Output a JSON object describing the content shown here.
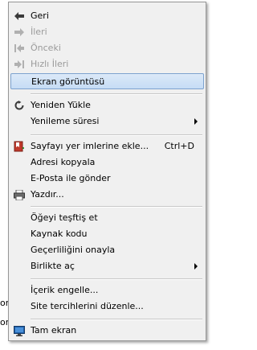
{
  "background": {
    "fragments": [
      "on",
      "on"
    ]
  },
  "menu": {
    "items": [
      {
        "label": "Geri",
        "icon": "back-arrow-icon",
        "enabled": true
      },
      {
        "label": "İleri",
        "icon": "forward-arrow-icon",
        "enabled": false
      },
      {
        "label": "Önceki",
        "icon": "previous-icon",
        "enabled": false
      },
      {
        "label": "Hızlı İleri",
        "icon": "fast-forward-icon",
        "enabled": false
      },
      {
        "label": "Ekran görüntüsü",
        "highlighted": true
      },
      {
        "label": "Yeniden Yükle",
        "icon": "reload-icon"
      },
      {
        "label": "Yenileme süresi",
        "submenu": true
      },
      {
        "label": "Sayfayı yer imlerine ekle...",
        "icon": "bookmark-icon",
        "shortcut": "Ctrl+D"
      },
      {
        "label": "Adresi kopyala"
      },
      {
        "label": "E-Posta ile gönder"
      },
      {
        "label": "Yazdır...",
        "icon": "printer-icon"
      },
      {
        "label": "Öğeyi teşftiş et"
      },
      {
        "label": "Kaynak kodu"
      },
      {
        "label": "Geçerliliğini onayla"
      },
      {
        "label": "Birlikte aç",
        "submenu": true
      },
      {
        "label": "İçerik engelle..."
      },
      {
        "label": "Site tercihlerini düzenle..."
      },
      {
        "label": "Tam ekran",
        "icon": "fullscreen-monitor-icon"
      }
    ]
  },
  "colors": {
    "menu_bg": "#f0f0f0",
    "highlight_border": "#7da2ce",
    "disabled_text": "#9a9a9a"
  }
}
